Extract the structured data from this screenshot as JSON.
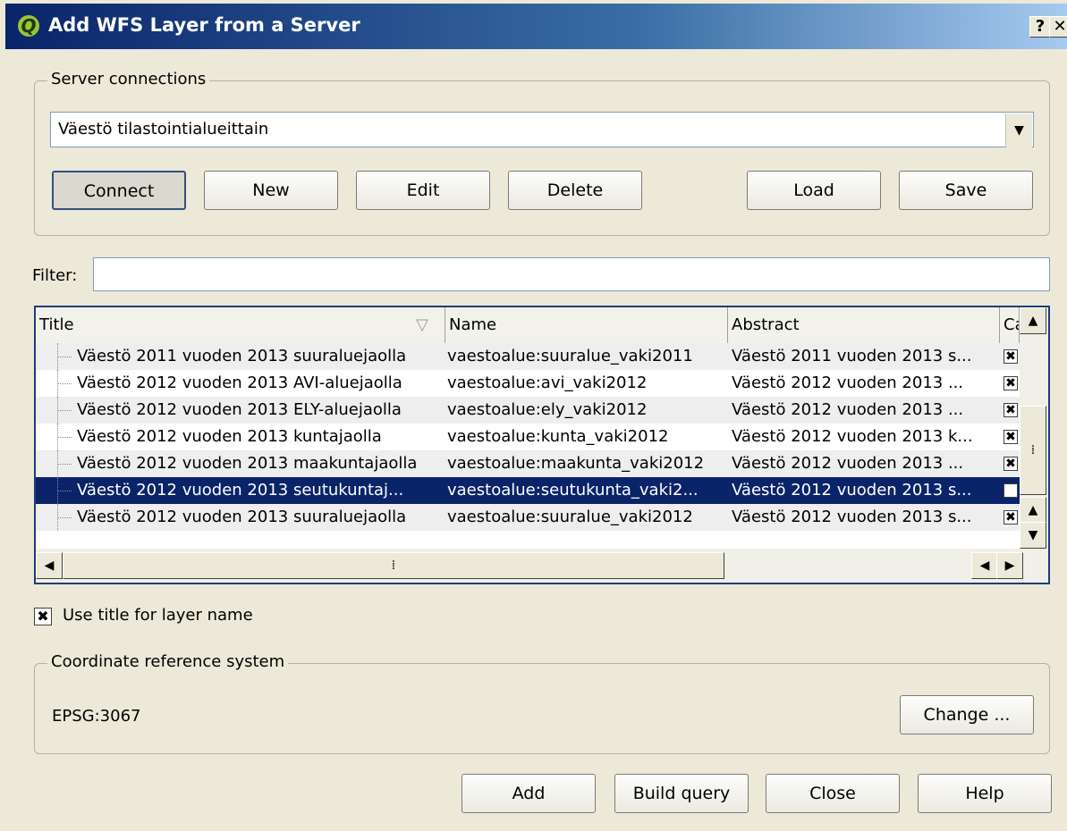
{
  "window": {
    "title": "Add WFS Layer from a Server",
    "help_btn": "?",
    "close_btn": "✕"
  },
  "server": {
    "group_label": "Server connections",
    "selected": "Väestö tilastointialueittain",
    "buttons": {
      "connect": "Connect",
      "new": "New",
      "edit": "Edit",
      "delete": "Delete",
      "load": "Load",
      "save": "Save"
    }
  },
  "filter": {
    "label": "Filter:",
    "value": ""
  },
  "table": {
    "columns": {
      "title": "Title",
      "name": "Name",
      "abstract": "Abstract",
      "cache": "Ca"
    },
    "rows": [
      {
        "title": "Väestö 2011 vuoden 2013 suuraluejaolla",
        "name": "vaestoalue:suuralue_vaki2011",
        "abstract": "Väestö 2011 vuoden 2013 s..."
      },
      {
        "title": "Väestö 2012 vuoden 2013 AVI-aluejaolla",
        "name": "vaestoalue:avi_vaki2012",
        "abstract": "Väestö 2012 vuoden 2013 ..."
      },
      {
        "title": "Väestö 2012 vuoden 2013 ELY-aluejaolla",
        "name": "vaestoalue:ely_vaki2012",
        "abstract": "Väestö 2012 vuoden 2013 ..."
      },
      {
        "title": "Väestö 2012 vuoden 2013 kuntajaolla",
        "name": "vaestoalue:kunta_vaki2012",
        "abstract": "Väestö 2012 vuoden 2013 k..."
      },
      {
        "title": "Väestö 2012 vuoden 2013 maakuntajaolla",
        "name": "vaestoalue:maakunta_vaki2012",
        "abstract": "Väestö 2012 vuoden 2013 ..."
      },
      {
        "title": "Väestö 2012 vuoden 2013 seutukuntaj...",
        "name": "vaestoalue:seutukunta_vaki2...",
        "abstract": "Väestö 2012 vuoden 2013 s..."
      },
      {
        "title": "Väestö 2012 vuoden 2013 suuraluejaolla",
        "name": "vaestoalue:suuralue_vaki2012",
        "abstract": "Väestö 2012 vuoden 2013 s..."
      }
    ],
    "selected_row": 5
  },
  "options": {
    "use_title_label": "Use title for layer name",
    "use_title_checked": true
  },
  "crs": {
    "group_label": "Coordinate reference system",
    "value": "EPSG:3067",
    "change": "Change ..."
  },
  "footer": {
    "add": "Add",
    "build_query": "Build query",
    "close": "Close",
    "help": "Help"
  }
}
